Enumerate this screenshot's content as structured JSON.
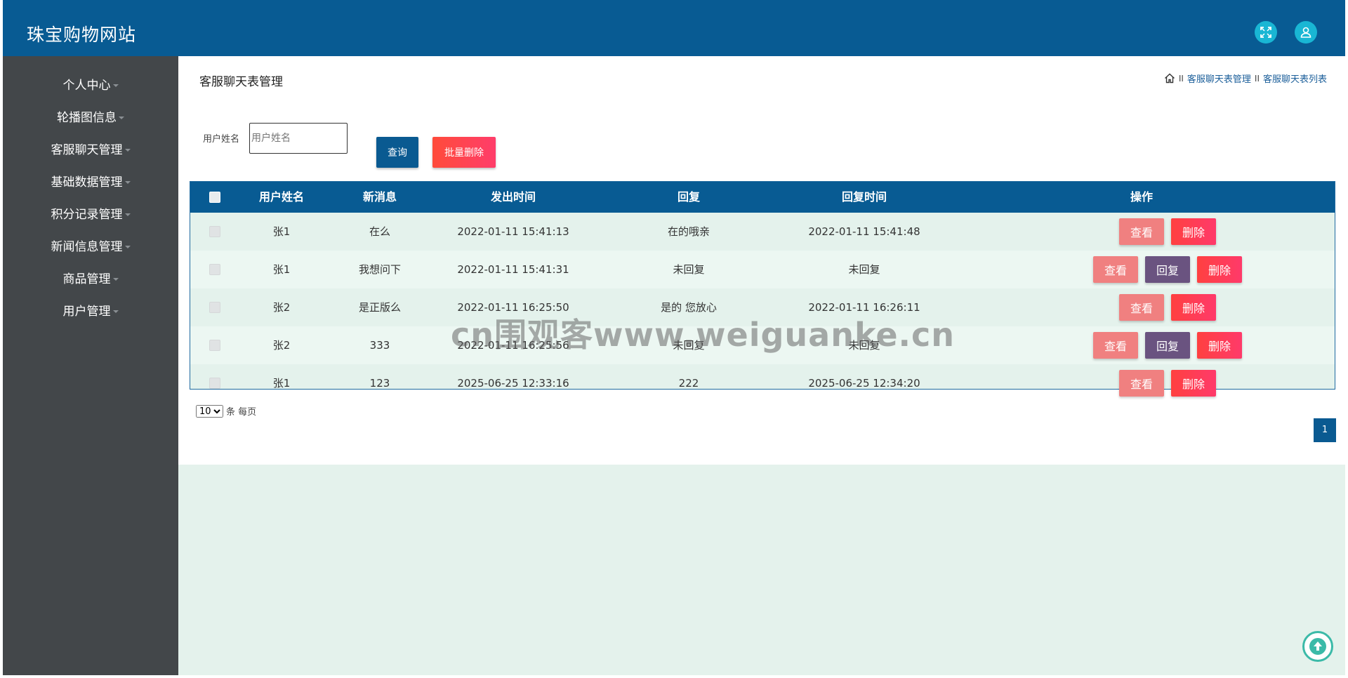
{
  "app": {
    "title": "珠宝购物网站"
  },
  "header": {
    "fullscreen_icon": "fullscreen-icon",
    "user_icon": "user-icon"
  },
  "sidebar": {
    "items": [
      {
        "label": "个人中心"
      },
      {
        "label": "轮播图信息"
      },
      {
        "label": "客服聊天管理"
      },
      {
        "label": "基础数据管理"
      },
      {
        "label": "积分记录管理"
      },
      {
        "label": "新闻信息管理"
      },
      {
        "label": "商品管理"
      },
      {
        "label": "用户管理"
      }
    ]
  },
  "page": {
    "title": "客服聊天表管理",
    "breadcrumb": {
      "home_icon": "home-icon",
      "separator": "II",
      "item1": "客服聊天表管理",
      "item2": "客服聊天表列表"
    }
  },
  "search": {
    "label": "用户姓名",
    "placeholder": "用户姓名",
    "value": "",
    "query_label": "查询",
    "batch_delete_label": "批量删除"
  },
  "table": {
    "columns": {
      "name": "用户姓名",
      "message": "新消息",
      "sent_time": "发出时间",
      "reply": "回复",
      "reply_time": "回复时间",
      "actions": "操作"
    },
    "rows": [
      {
        "name": "张1",
        "message": "在么",
        "sent_time": "2022-01-11 15:41:13",
        "reply": "在的哦亲",
        "reply_time": "2022-01-11 15:41:48"
      },
      {
        "name": "张1",
        "message": "我想问下",
        "sent_time": "2022-01-11 15:41:31",
        "reply": "未回复",
        "reply_time": "未回复"
      },
      {
        "name": "张2",
        "message": "是正版么",
        "sent_time": "2022-01-11 16:25:50",
        "reply": "是的 您放心",
        "reply_time": "2022-01-11 16:26:11"
      },
      {
        "name": "张2",
        "message": "333",
        "sent_time": "2022-01-11 16:25:56",
        "reply": "未回复",
        "reply_time": "未回复"
      },
      {
        "name": "张1",
        "message": "123",
        "sent_time": "2025-06-25 12:33:16",
        "reply": "222",
        "reply_time": "2025-06-25 12:34:20"
      }
    ],
    "actions": {
      "view": "查看",
      "reply": "回复",
      "delete": "删除"
    }
  },
  "pagination": {
    "page_size": "10",
    "page_size_suffix": "条 每页",
    "current_page": "1"
  },
  "watermark": "cn围观客www.weiguanke.cn",
  "colors": {
    "primary": "#085b93",
    "sidebar": "#43474a",
    "background": "#e4f2ec",
    "view_button": "#f08080",
    "reply_button": "#6a5380",
    "delete_button": "#ff3d5a"
  }
}
